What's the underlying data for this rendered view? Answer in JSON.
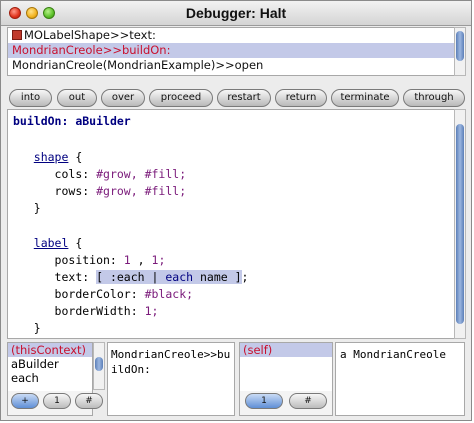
{
  "window": {
    "title": "Debugger: Halt"
  },
  "stack": {
    "frames": [
      {
        "label": "MOLabelShape>>text:"
      },
      {
        "label": "MondrianCreole>>buildOn:"
      },
      {
        "label": "MondrianCreole(MondrianExample)>>open"
      }
    ]
  },
  "toolbar": {
    "buttons": [
      "into",
      "out",
      "over",
      "proceed",
      "restart",
      "return",
      "terminate",
      "through"
    ]
  },
  "code": {
    "line1_selector": "buildOn:",
    "line1_arg": "aBuilder",
    "shape_kw": "shape",
    "brace_open": "{",
    "cols_label": "cols:",
    "cols_val": "#grow, #fill;",
    "rows_label": "rows:",
    "rows_val": "#grow, #fill;",
    "brace_close": "}",
    "label_kw": "label",
    "position_label": "position:",
    "position_v1": "1",
    "position_comma": ",",
    "position_v2": "1;",
    "text_label": "text:",
    "text_block_open": "[ :each | ",
    "text_block_each": "each",
    "text_block_rest": " name ]",
    "text_semicolon": ";",
    "border_color_label": "borderColor:",
    "border_color_val": "#black;",
    "border_width_label": "borderWidth:",
    "border_width_val": "1;"
  },
  "context_inspector": {
    "items": [
      "(thisContext)",
      "aBuilder",
      "each"
    ],
    "value": "MondrianCreole>>buildOn:",
    "buttons": [
      "+",
      "1",
      "#"
    ]
  },
  "receiver_inspector": {
    "items": [
      "(self)"
    ],
    "value": "a MondrianCreole",
    "buttons": [
      "1",
      "#"
    ]
  },
  "colors": {
    "selection": "#c3c9e8",
    "selected_frame_text": "#c8102e",
    "keyword": "#000080",
    "literal": "#7a1a7a",
    "scroll_thumb": "#6f8fc8"
  }
}
